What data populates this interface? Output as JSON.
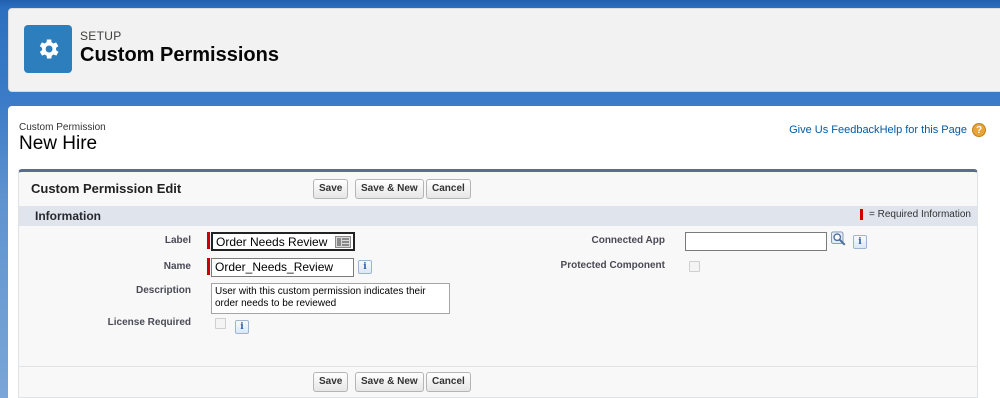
{
  "header": {
    "setup_label": "SETUP",
    "title": "Custom Permissions",
    "icon": "gear-icon"
  },
  "page": {
    "object_type": "Custom Permission",
    "record_name": "New Hire",
    "feedback_link": "Give Us Feedback",
    "help_link": "Help for this Page",
    "help_icon_glyph": "?"
  },
  "edit_block": {
    "title": "Custom Permission Edit",
    "buttons": {
      "save": "Save",
      "save_new": "Save & New",
      "cancel": "Cancel"
    }
  },
  "section": {
    "title": "Information",
    "required_legend": "= Required Information"
  },
  "fields": {
    "label": {
      "label": "Label",
      "value": "Order Needs Review"
    },
    "name": {
      "label": "Name",
      "value": "Order_Needs_Review"
    },
    "description": {
      "label": "Description",
      "value": "User with this custom permission indicates their order needs to be reviewed"
    },
    "license_required": {
      "label": "License Required",
      "checked": false
    },
    "connected_app": {
      "label": "Connected App",
      "value": ""
    },
    "protected_component": {
      "label": "Protected Component",
      "checked": false
    }
  },
  "info_glyph": "i",
  "colors": {
    "brand": "#2d7ebd",
    "required": "#cc0000",
    "link": "#015ba7",
    "section_header": "#dfe4ed"
  }
}
